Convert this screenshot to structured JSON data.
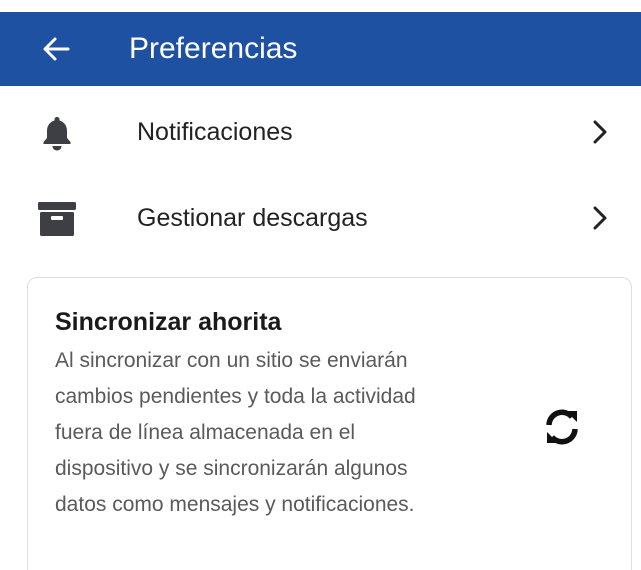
{
  "appbar": {
    "title": "Preferencias",
    "back_icon": "arrow-left-icon",
    "background": "#1f51a3"
  },
  "menu": {
    "items": [
      {
        "label": "Notificaciones",
        "icon": "bell-icon",
        "trailing_icon": "chevron-right-icon"
      },
      {
        "label": "Gestionar descargas",
        "icon": "archive-box-icon",
        "trailing_icon": "chevron-right-icon"
      }
    ]
  },
  "sync": {
    "title": "Sincronizar ahorita",
    "description": "Al sincronizar con un sitio se enviarán cambios pendientes y toda la actividad fuera de línea almacenada en el dispositivo y se sincronizarán algunos datos como mensajes y notificaciones.",
    "icon": "sync-icon"
  }
}
